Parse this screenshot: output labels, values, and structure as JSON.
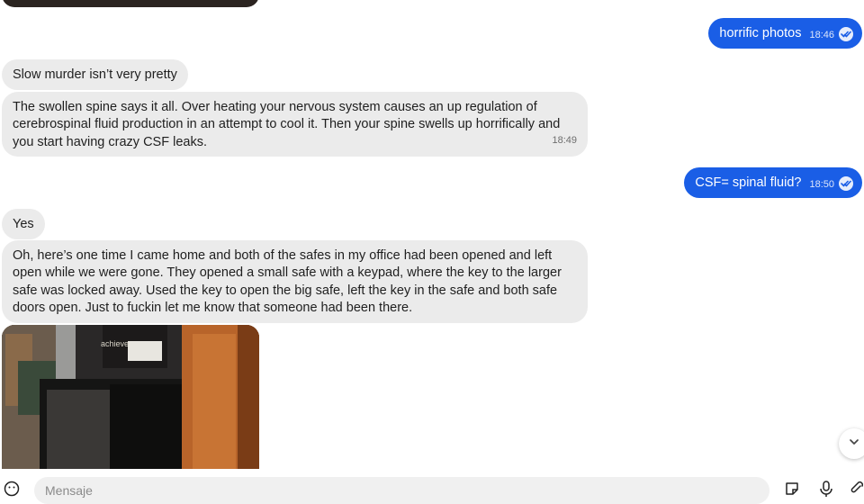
{
  "messages": [
    {
      "text": "horrific photos",
      "time": "18:46"
    },
    {
      "text": "Slow murder isn’t very pretty"
    },
    {
      "text": "The swollen spine says it all. Over heating your nervous system causes an up regulation of cerebrospinal fluid production in an attempt to cool it. Then your spine swells up horrifically and you start having crazy CSF leaks.",
      "time": "18:49"
    },
    {
      "text": "CSF= spinal fluid?",
      "time": "18:50"
    },
    {
      "text": "Yes"
    },
    {
      "text": "Oh, here’s one time I came home and both of the safes in my office had been opened and left open while we were gone. They opened a small safe with a keypad, where the key to the larger safe was locked away. Used the key to open the big safe, left the key in the safe and both safe doors open. Just to fuckin let me know that someone had been there."
    }
  ],
  "photo_text": {
    "brand": "achieve"
  },
  "composer": {
    "placeholder": "Mensaje"
  },
  "icons": {
    "emoji": "smiley-icon",
    "sticker": "sticker-icon",
    "mic": "microphone-icon",
    "attach": "paperclip-icon",
    "scroll": "chevron-down-icon",
    "read": "double-check-icon"
  },
  "colors": {
    "outgoing_bubble": "#1a5ee6",
    "incoming_bubble": "#ebebeb"
  }
}
